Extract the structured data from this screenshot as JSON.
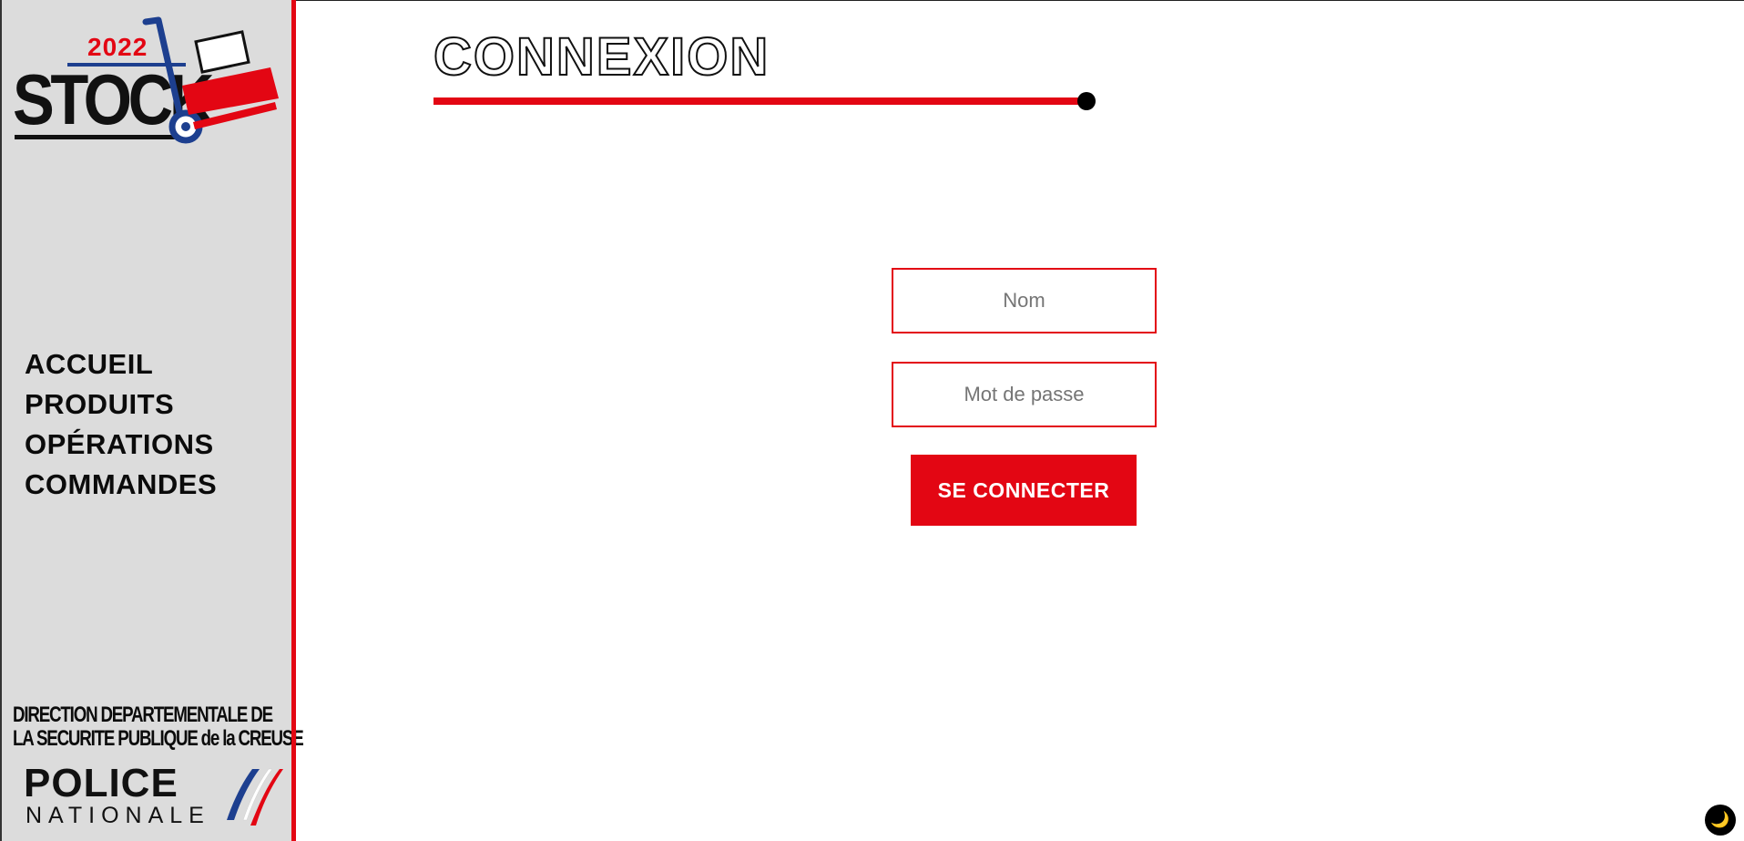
{
  "sidebar": {
    "logo": {
      "year": "2022",
      "word": "STOCK"
    },
    "nav": [
      {
        "label": "ACCUEIL"
      },
      {
        "label": "PRODUITS"
      },
      {
        "label": "OPÉRATIONS"
      },
      {
        "label": "COMMANDES"
      }
    ],
    "footer": {
      "direction_line1": "DIRECTION DEPARTEMENTALE DE",
      "direction_line2": "LA SECURITE PUBLIQUE de la CREUSE",
      "police": "POLICE",
      "nationale": "NATIONALE"
    }
  },
  "main": {
    "title": "CONNEXION",
    "form": {
      "name_placeholder": "Nom",
      "password_placeholder": "Mot de passe",
      "submit_label": "SE CONNECTER"
    }
  },
  "theme_toggle": {
    "icon": "moon-icon",
    "glyph": "🌙"
  },
  "colors": {
    "accent": "#e30613",
    "sidebar_bg": "#dcdcdc",
    "logo_blue": "#1d3f8f"
  }
}
